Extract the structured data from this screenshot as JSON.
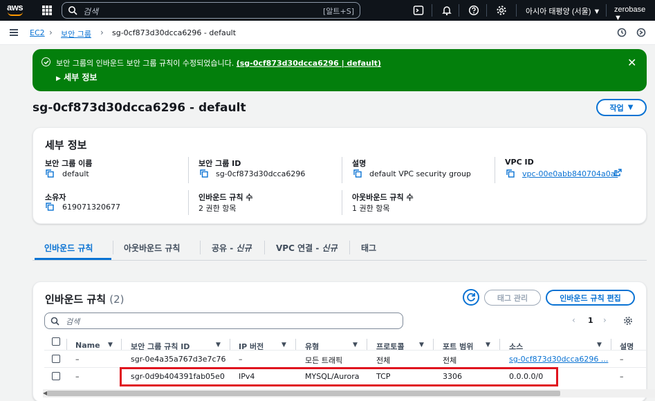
{
  "topnav": {
    "logo": "aws",
    "search_placeholder": "검색",
    "search_shortcut": "[알트+S]",
    "region": "아시아 태평양 (서울)",
    "account": "zerobase"
  },
  "breadcrumb": {
    "items": [
      "EC2",
      "보안 그룹",
      "sg-0cf873d30dcca6296 - default"
    ]
  },
  "flash": {
    "message": "보안 그룹의 인바운드 보안 그룹 규칙이 수정되었습니다.",
    "link": "(sg-0cf873d30dcca6296 | default)",
    "details_label": "세부 정보",
    "color": "#037f0c"
  },
  "page": {
    "title": "sg-0cf873d30dcca6296 - default",
    "actions_label": "작업"
  },
  "details": {
    "title": "세부 정보",
    "fields": [
      {
        "label": "보안 그룹 이름",
        "value": "default"
      },
      {
        "label": "보안 그룹 ID",
        "value": "sg-0cf873d30dcca6296"
      },
      {
        "label": "설명",
        "value": "default VPC security group"
      },
      {
        "label": "VPC ID",
        "value": "vpc-00e0abb840704a0af"
      },
      {
        "label": "소유자",
        "value": "619071320677"
      },
      {
        "label": "인바운드 규칙 수",
        "value": "2 권한 항목"
      },
      {
        "label": "아웃바운드 규칙 수",
        "value": "1 권한 항목"
      }
    ]
  },
  "tabs": [
    {
      "label": "인바운드 규칙",
      "suffix": ""
    },
    {
      "label": "아웃바운드 규칙",
      "suffix": ""
    },
    {
      "label": "공유 - ",
      "suffix": "신규"
    },
    {
      "label": "VPC 연결 - ",
      "suffix": "신규"
    },
    {
      "label": "태그",
      "suffix": ""
    }
  ],
  "rules": {
    "title": "인바운드 규칙",
    "count": "(2)",
    "tag_button": "태그 관리",
    "edit_button": "인바운드 규칙 편집",
    "search_placeholder": "검색",
    "page_number": "1",
    "columns": [
      "Name",
      "보안 그룹 규칙 ID",
      "IP 버전",
      "유형",
      "프로토콜",
      "포트 범위",
      "소스",
      "설명"
    ],
    "rows": [
      {
        "name": "–",
        "id": "sgr-0e4a35a767d3e7c76",
        "ip": "–",
        "type": "모든 트래픽",
        "protocol": "전체",
        "port": "전체",
        "source": "sg-0cf873d30dcca6296 ...",
        "desc": "–"
      },
      {
        "name": "–",
        "id": "sgr-0d9b404391fab05e0",
        "ip": "IPv4",
        "type": "MYSQL/Aurora",
        "protocol": "TCP",
        "port": "3306",
        "source": "0.0.0.0/0",
        "desc": "–"
      }
    ]
  },
  "colors": {
    "link": "#0972d3",
    "highlight": "#e0141e",
    "nav": "#0f141a"
  }
}
